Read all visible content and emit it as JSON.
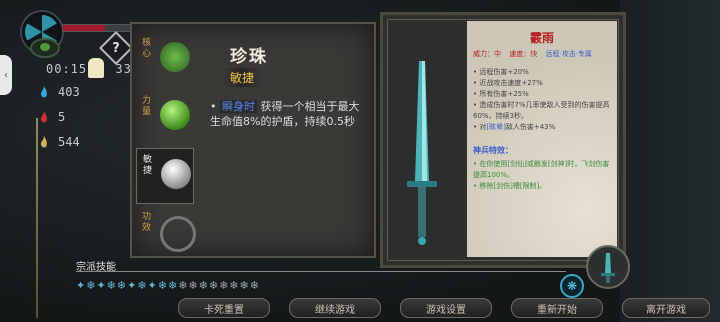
{
  "hud": {
    "help_symbol": "?",
    "timer": "00:15",
    "timer_suffix": "33",
    "stat_blue": "403",
    "stat_red": "5",
    "stat_gold": "544"
  },
  "colors": {
    "accent_blue": "#5fb7d5",
    "gold": "#f0c14a",
    "red_title": "#b5221f",
    "hp_red": "#a3182a"
  },
  "slots": [
    {
      "label": "核心",
      "gem_color": "#4c9a39",
      "icon": "dragon-gem-icon"
    },
    {
      "label": "力量",
      "gem_color": "#5bbf2e",
      "icon": "green-jade-icon"
    },
    {
      "label": "敏捷",
      "gem_color": "#d9d9d9",
      "icon": "pearl-icon"
    },
    {
      "label": "功效",
      "gem_color": "#cf5fd6",
      "icon": "purple-ring-icon"
    }
  ],
  "item": {
    "title": "珍珠",
    "tag": "敏捷",
    "bullet": "•",
    "keyword": "瞬身时",
    "description": "获得一个相当于最大生命值8%的护盾，持续0.5秒"
  },
  "weapon": {
    "name": "霰雨",
    "tags": [
      "威力：中",
      "速度：快",
      "远程·攻击·专属"
    ],
    "lines_plain": [
      "远程伤害+20%",
      "近战攻击速度+27%",
      "所有伤害+25%",
      "造成伤害时7%几率使敌人受到的伤害提高60%，持续3秒。"
    ],
    "line_kw_prefix": "对",
    "line_kw": "[眩晕]",
    "line_kw_suffix": "敌人伤害+43%",
    "subtitle": "神兵特效：",
    "green_lines": [
      "在你使用[剑仙]或触发[剑神]时，飞剑伤害提高100%。",
      "移除[剑伤]槽[限制]。"
    ]
  },
  "skills": {
    "label": "宗派技能",
    "icons": [
      "✦",
      "❄",
      "✦",
      "❄",
      "❄",
      "✦",
      "❄",
      "✦",
      "❄",
      "❄",
      "❄",
      "❄",
      "❄",
      "❄",
      "❄",
      "❄",
      "❄",
      "❄"
    ],
    "round_button_symbol": "❋"
  },
  "buttons": [
    {
      "label": "卡死重置"
    },
    {
      "label": "继续游戏"
    },
    {
      "label": "游戏设置"
    },
    {
      "label": "重新开始"
    },
    {
      "label": "离开游戏"
    }
  ]
}
